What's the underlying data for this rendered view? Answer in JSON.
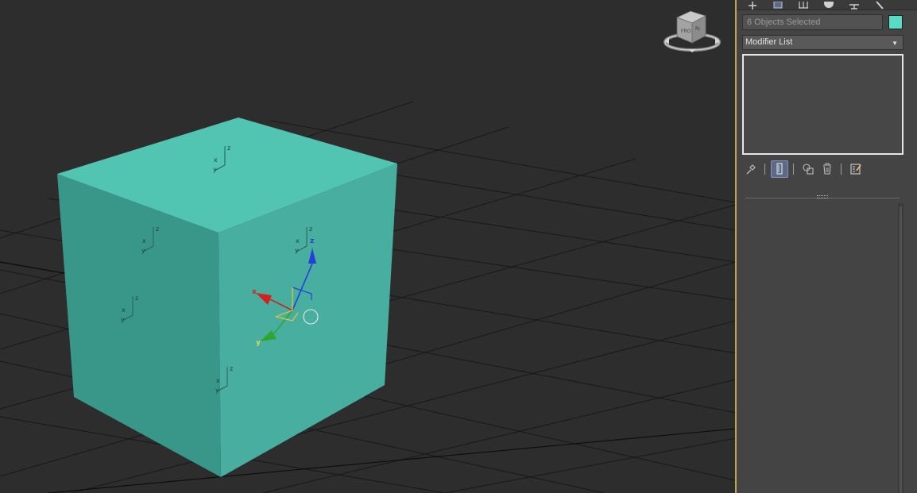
{
  "viewport": {
    "selected_objects": 6,
    "colors": {
      "background": "#2d2d2d",
      "grid": "#181818",
      "box_top": "#52c4b2",
      "box_left": "#399789",
      "box_right": "#48ae9f",
      "gizmo_x": "#d42020",
      "gizmo_y": "#2fa72f",
      "gizmo_z": "#2440d8"
    },
    "axis_labels": {
      "x": "x",
      "y": "y",
      "z": "z"
    },
    "viewcube": {
      "faces": [
        "TOP",
        "FRONT",
        "RIGHT"
      ],
      "icon": "viewcube-icon"
    }
  },
  "command_panel": {
    "tabs": [
      {
        "name": "create-tab",
        "icon": "plus-icon"
      },
      {
        "name": "modify-tab",
        "icon": "modify-icon"
      },
      {
        "name": "hierarchy-tab",
        "icon": "hierarchy-icon"
      },
      {
        "name": "motion-tab",
        "icon": "motion-icon"
      },
      {
        "name": "display-tab",
        "icon": "display-icon"
      },
      {
        "name": "utilities-tab",
        "icon": "wrench-icon"
      }
    ],
    "selection_name": "6 Objects Selected",
    "object_color": "#59dcc4",
    "modifier_list": "Modifier List",
    "stack_tools": [
      {
        "name": "pin-stack-button",
        "icon": "pin-icon"
      },
      {
        "name": "show-end-result-button",
        "icon": "show-end-result-icon",
        "active": true
      },
      {
        "name": "make-unique-button",
        "icon": "make-unique-icon"
      },
      {
        "name": "remove-modifier-button",
        "icon": "trash-icon"
      },
      {
        "name": "configure-modifier-sets-button",
        "icon": "configure-icon"
      }
    ],
    "accent_color": "#c8a24a"
  }
}
